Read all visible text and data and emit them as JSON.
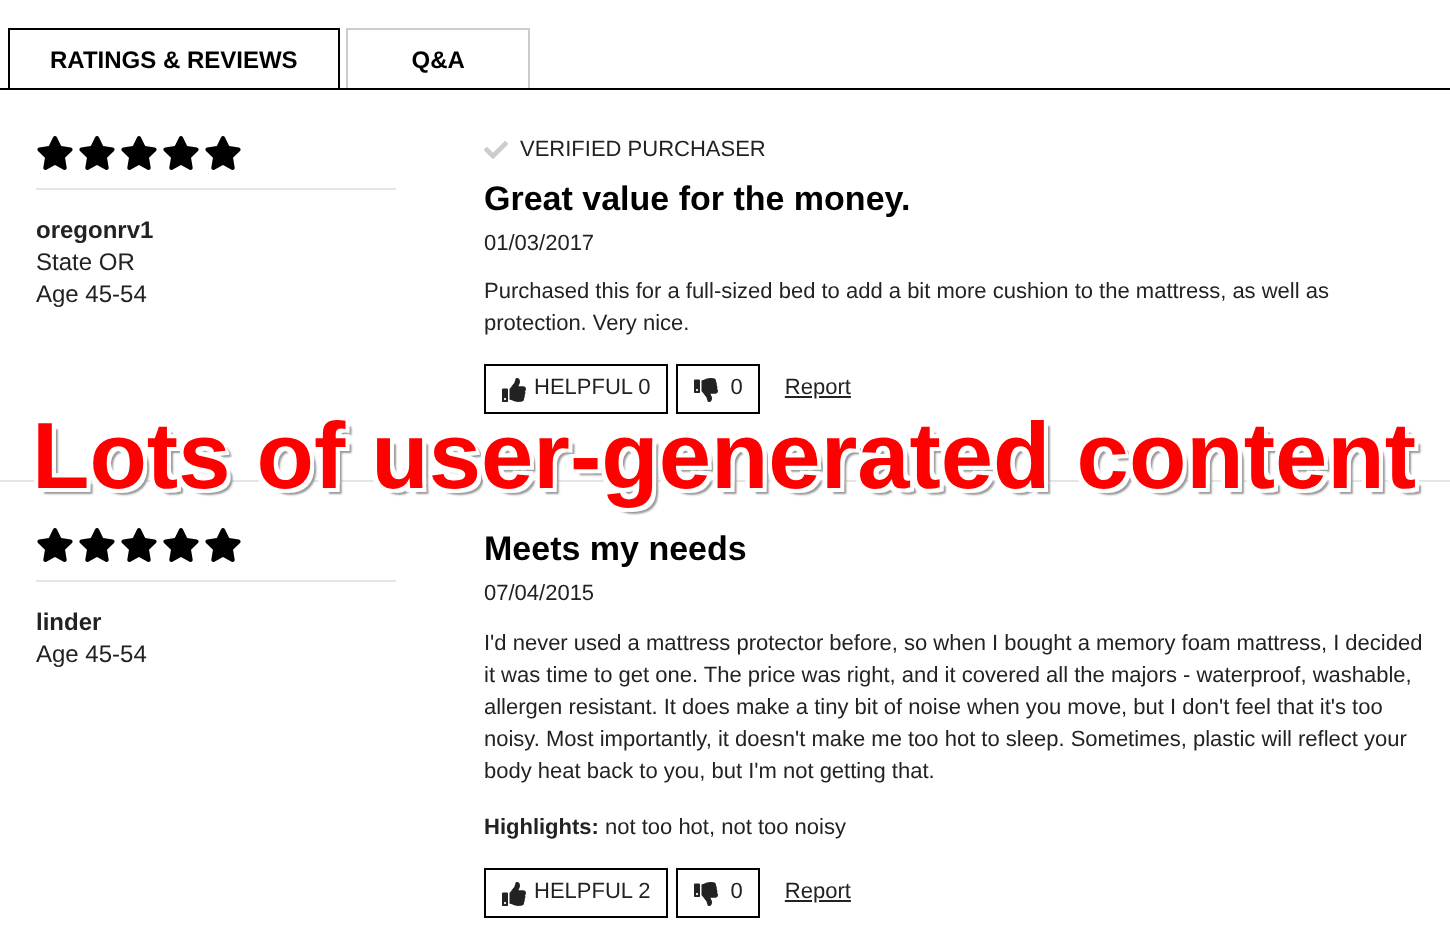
{
  "tabs": [
    {
      "label": "RATINGS & REVIEWS",
      "selected": true
    },
    {
      "label": "Q&A",
      "selected": false
    }
  ],
  "reviews": [
    {
      "stars": 5,
      "verified_label": "VERIFIED PURCHASER",
      "username": "oregonrv1",
      "details": [
        "State OR",
        "Age 45-54"
      ],
      "title": "Great value for the money.",
      "date": "01/03/2017",
      "body": "Purchased this for a full-sized bed to add a bit more cushion to the mattress, as well as protection. Very nice.",
      "helpful": "HELPFUL 0",
      "unhelpful": "0",
      "report": "Report"
    },
    {
      "stars": 5,
      "username": "linder",
      "details": [
        "Age 45-54"
      ],
      "title": "Meets my needs",
      "date": "07/04/2015",
      "body": "I'd never used a mattress protector before, so when I bought a memory foam mattress, I decided it was time to get one. The price was right, and it covered all the majors - waterproof, washable, allergen resistant. It does make a tiny bit of noise when you move, but I don't feel that it's too noisy. Most importantly, it doesn't make me too hot to sleep. Sometimes, plastic will reflect your body heat back to you, but I'm not getting that.",
      "highlights": "**Highlights:** not too hot, not too noisy",
      "helpful": "HELPFUL 2",
      "unhelpful": "0",
      "report": "Report"
    }
  ],
  "callout": "Lots of user-generated content"
}
